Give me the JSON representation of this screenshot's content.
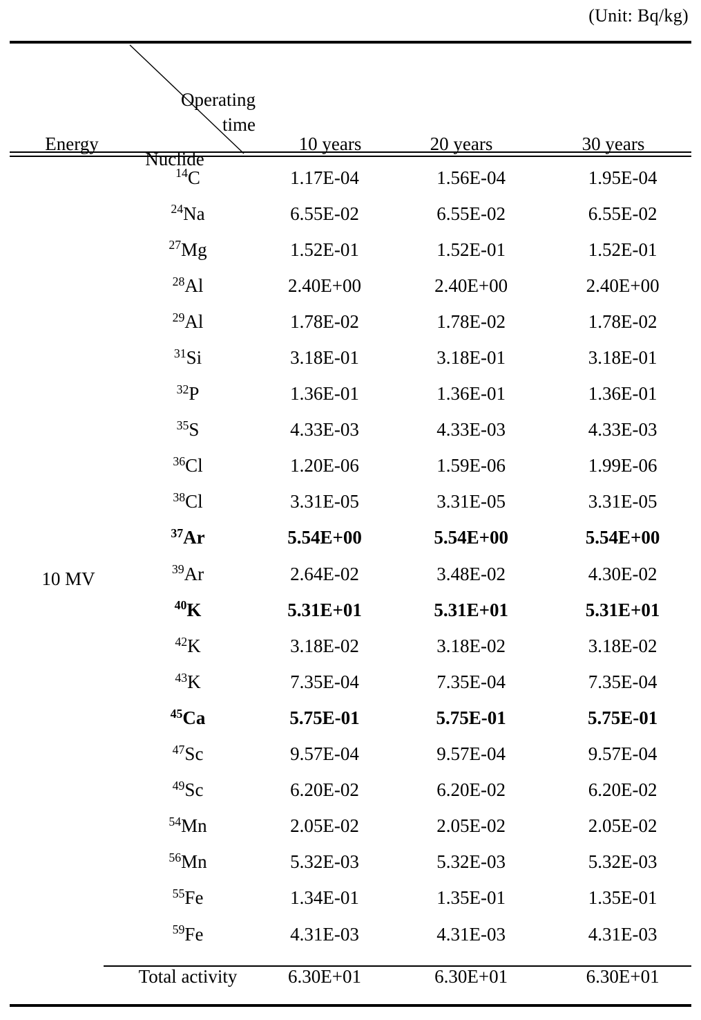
{
  "caption": {
    "unit": "(Unit:  Bq/kg)"
  },
  "header": {
    "energy_label": "Energy",
    "operating_line1": "Operating",
    "operating_line2": "time",
    "nuclide_label": "Nuclide",
    "columns": [
      "10  years",
      "20  years",
      "30  years"
    ]
  },
  "body": {
    "energy_value": "10  MV",
    "total_label": "Total  activity",
    "totals": [
      "6.30E+01",
      "6.30E+01",
      "6.30E+01"
    ]
  },
  "chart_data": {
    "type": "table",
    "title": "Activation nuclide specific activity by operating time",
    "unit": "Bq/kg",
    "row_group_label": "10  MV",
    "columns": [
      "Nuclide",
      "10  years",
      "20  years",
      "30  years"
    ],
    "rows": [
      {
        "mass": "14",
        "element": "C",
        "bold": false,
        "values": [
          "1.17E-04",
          "1.56E-04",
          "1.95E-04"
        ]
      },
      {
        "mass": "24",
        "element": "Na",
        "bold": false,
        "values": [
          "6.55E-02",
          "6.55E-02",
          "6.55E-02"
        ]
      },
      {
        "mass": "27",
        "element": "Mg",
        "bold": false,
        "values": [
          "1.52E-01",
          "1.52E-01",
          "1.52E-01"
        ]
      },
      {
        "mass": "28",
        "element": "Al",
        "bold": false,
        "values": [
          "2.40E+00",
          "2.40E+00",
          "2.40E+00"
        ]
      },
      {
        "mass": "29",
        "element": "Al",
        "bold": false,
        "values": [
          "1.78E-02",
          "1.78E-02",
          "1.78E-02"
        ]
      },
      {
        "mass": "31",
        "element": "Si",
        "bold": false,
        "values": [
          "3.18E-01",
          "3.18E-01",
          "3.18E-01"
        ]
      },
      {
        "mass": "32",
        "element": "P",
        "bold": false,
        "values": [
          "1.36E-01",
          "1.36E-01",
          "1.36E-01"
        ]
      },
      {
        "mass": "35",
        "element": "S",
        "bold": false,
        "values": [
          "4.33E-03",
          "4.33E-03",
          "4.33E-03"
        ]
      },
      {
        "mass": "36",
        "element": "Cl",
        "bold": false,
        "values": [
          "1.20E-06",
          "1.59E-06",
          "1.99E-06"
        ]
      },
      {
        "mass": "38",
        "element": "Cl",
        "bold": false,
        "values": [
          "3.31E-05",
          "3.31E-05",
          "3.31E-05"
        ]
      },
      {
        "mass": "37",
        "element": "Ar",
        "bold": true,
        "values": [
          "5.54E+00",
          "5.54E+00",
          "5.54E+00"
        ]
      },
      {
        "mass": "39",
        "element": "Ar",
        "bold": false,
        "values": [
          "2.64E-02",
          "3.48E-02",
          "4.30E-02"
        ]
      },
      {
        "mass": "40",
        "element": "K",
        "bold": true,
        "values": [
          "5.31E+01",
          "5.31E+01",
          "5.31E+01"
        ]
      },
      {
        "mass": "42",
        "element": "K",
        "bold": false,
        "values": [
          "3.18E-02",
          "3.18E-02",
          "3.18E-02"
        ]
      },
      {
        "mass": "43",
        "element": "K",
        "bold": false,
        "values": [
          "7.35E-04",
          "7.35E-04",
          "7.35E-04"
        ]
      },
      {
        "mass": "45",
        "element": "Ca",
        "bold": true,
        "values": [
          "5.75E-01",
          "5.75E-01",
          "5.75E-01"
        ]
      },
      {
        "mass": "47",
        "element": "Sc",
        "bold": false,
        "values": [
          "9.57E-04",
          "9.57E-04",
          "9.57E-04"
        ]
      },
      {
        "mass": "49",
        "element": "Sc",
        "bold": false,
        "values": [
          "6.20E-02",
          "6.20E-02",
          "6.20E-02"
        ]
      },
      {
        "mass": "54",
        "element": "Mn",
        "bold": false,
        "values": [
          "2.05E-02",
          "2.05E-02",
          "2.05E-02"
        ]
      },
      {
        "mass": "56",
        "element": "Mn",
        "bold": false,
        "values": [
          "5.32E-03",
          "5.32E-03",
          "5.32E-03"
        ]
      },
      {
        "mass": "55",
        "element": "Fe",
        "bold": false,
        "values": [
          "1.34E-01",
          "1.35E-01",
          "1.35E-01"
        ]
      },
      {
        "mass": "59",
        "element": "Fe",
        "bold": false,
        "values": [
          "4.31E-03",
          "4.31E-03",
          "4.31E-03"
        ]
      }
    ],
    "total_row": {
      "label": "Total  activity",
      "values": [
        "6.30E+01",
        "6.30E+01",
        "6.30E+01"
      ]
    }
  }
}
